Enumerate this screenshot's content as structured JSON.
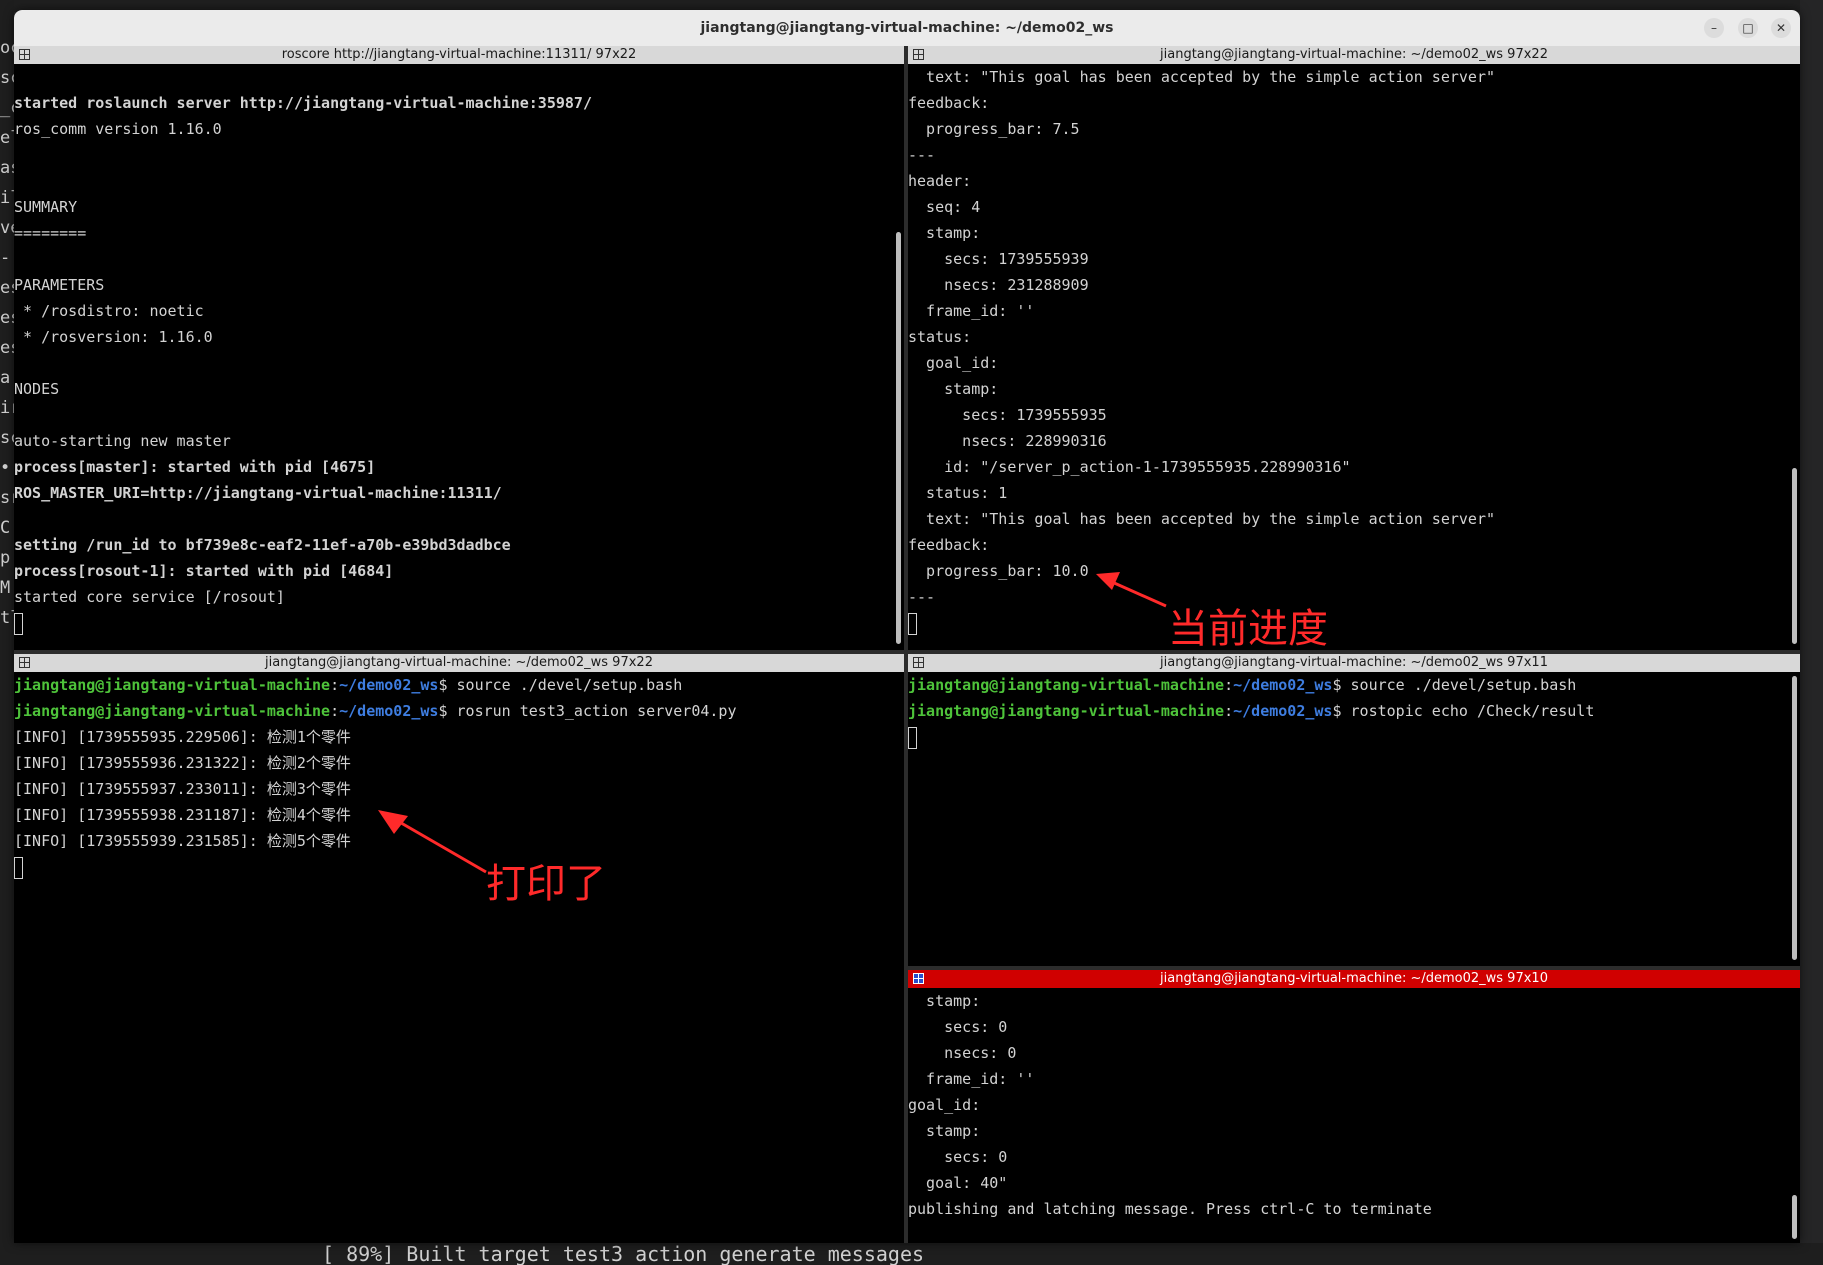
{
  "window": {
    "title": "jiangtang@jiangtang-virtual-machine: ~/demo02_ws",
    "minimize_glyph": "–",
    "maximize_glyph": "□",
    "close_glyph": "✕"
  },
  "background": {
    "left_fragments": [
      "oc",
      "sc",
      "_c",
      "el",
      "as",
      "ilo",
      "ve",
      "-",
      "es",
      "es",
      "es",
      "a",
      "ir",
      "sc",
      "•",
      "sr",
      "C",
      "p",
      "M",
      "tl"
    ],
    "bottom_text": "[ 89%] Built target test3_action_generate_messages"
  },
  "pane_top_left": {
    "header": "roscore http://jiangtang-virtual-machine:11311/ 97x22",
    "lines": [
      {
        "text": "",
        "bold": false
      },
      {
        "text": "started roslaunch server http://jiangtang-virtual-machine:35987/",
        "bold": true
      },
      {
        "text": "ros_comm version 1.16.0",
        "bold": false
      },
      {
        "text": "",
        "bold": false
      },
      {
        "text": "",
        "bold": false
      },
      {
        "text": "SUMMARY",
        "bold": false
      },
      {
        "text": "========",
        "bold": false
      },
      {
        "text": "",
        "bold": false
      },
      {
        "text": "PARAMETERS",
        "bold": false
      },
      {
        "text": " * /rosdistro: noetic",
        "bold": false
      },
      {
        "text": " * /rosversion: 1.16.0",
        "bold": false
      },
      {
        "text": "",
        "bold": false
      },
      {
        "text": "NODES",
        "bold": false
      },
      {
        "text": "",
        "bold": false
      },
      {
        "text": "auto-starting new master",
        "bold": false
      },
      {
        "text": "process[master]: started with pid [4675]",
        "bold": true
      },
      {
        "text": "ROS_MASTER_URI=http://jiangtang-virtual-machine:11311/",
        "bold": true
      },
      {
        "text": "",
        "bold": false
      },
      {
        "text": "setting /run_id to bf739e8c-eaf2-11ef-a70b-e39bd3dadbce",
        "bold": true
      },
      {
        "text": "process[rosout-1]: started with pid [4684]",
        "bold": true
      },
      {
        "text": "started core service [/rosout]",
        "bold": false
      }
    ]
  },
  "pane_top_right": {
    "header": "jiangtang@jiangtang-virtual-machine: ~/demo02_ws 97x22",
    "lines": [
      "  text: \"This goal has been accepted by the simple action server\"",
      "feedback:",
      "  progress_bar: 7.5",
      "---",
      "header:",
      "  seq: 4",
      "  stamp:",
      "    secs: 1739555939",
      "    nsecs: 231288909",
      "  frame_id: ''",
      "status:",
      "  goal_id:",
      "    stamp:",
      "      secs: 1739555935",
      "      nsecs: 228990316",
      "    id: \"/server_p_action-1-1739555935.228990316\"",
      "  status: 1",
      "  text: \"This goal has been accepted by the simple action server\"",
      "feedback:",
      "  progress_bar: 10.0",
      "---"
    ]
  },
  "pane_bottom_left": {
    "header": "jiangtang@jiangtang-virtual-machine: ~/demo02_ws 97x22",
    "prompt_user": "jiangtang@jiangtang-virtual-machine",
    "prompt_sep": ":",
    "prompt_path": "~/demo02_ws",
    "prompt_dollar": "$ ",
    "commands": [
      "source ./devel/setup.bash",
      "rosrun test3_action server04.py"
    ],
    "log_lines": [
      "[INFO] [1739555935.229506]: 检测1个零件",
      "[INFO] [1739555936.231322]: 检测2个零件",
      "[INFO] [1739555937.233011]: 检测3个零件",
      "[INFO] [1739555938.231187]: 检测4个零件",
      "[INFO] [1739555939.231585]: 检测5个零件"
    ]
  },
  "pane_mid_right": {
    "header": "jiangtang@jiangtang-virtual-machine: ~/demo02_ws 97x11",
    "commands": [
      "source ./devel/setup.bash",
      "rostopic echo /Check/result"
    ]
  },
  "pane_bottom_right": {
    "header": "jiangtang@jiangtang-virtual-machine: ~/demo02_ws 97x10",
    "lines": [
      "  stamp:",
      "    secs: 0",
      "    nsecs: 0",
      "  frame_id: ''",
      "goal_id:",
      "  stamp:",
      "    secs: 0",
      "  goal: 40\"",
      "publishing and latching message. Press ctrl-C to terminate"
    ]
  },
  "annotations": {
    "progress_label": "当前进度",
    "printed_label": "打印了",
    "color": "#ff2a2a"
  }
}
